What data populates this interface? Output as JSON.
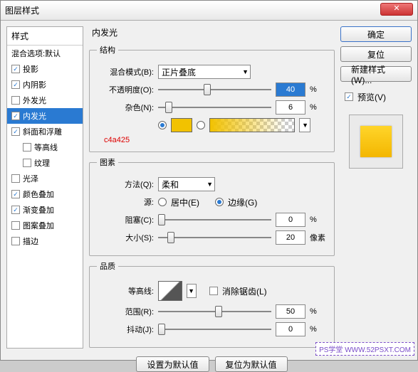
{
  "window": {
    "title": "图层样式",
    "close": "✕"
  },
  "left": {
    "header": "样式",
    "subheader": "混合选项:默认",
    "items": [
      {
        "label": "投影",
        "checked": true
      },
      {
        "label": "内阴影",
        "checked": true
      },
      {
        "label": "外发光",
        "checked": false
      },
      {
        "label": "内发光",
        "checked": true,
        "selected": true
      },
      {
        "label": "斜面和浮雕",
        "checked": true
      },
      {
        "label": "等高线",
        "checked": false,
        "indent": true
      },
      {
        "label": "纹理",
        "checked": false,
        "indent": true
      },
      {
        "label": "光泽",
        "checked": false
      },
      {
        "label": "颜色叠加",
        "checked": true
      },
      {
        "label": "渐变叠加",
        "checked": true
      },
      {
        "label": "图案叠加",
        "checked": false
      },
      {
        "label": "描边",
        "checked": false
      }
    ]
  },
  "mid": {
    "title": "内发光",
    "structure": {
      "legend": "结构",
      "blendMode": {
        "label": "混合模式(B):",
        "value": "正片叠底"
      },
      "opacity": {
        "label": "不透明度(O):",
        "value": "40",
        "unit": "%",
        "pos": 40
      },
      "noise": {
        "label": "杂色(N):",
        "value": "6",
        "unit": "%",
        "pos": 6
      },
      "colorSwatch": "#f2c200",
      "hexNote": "c4a425"
    },
    "elements": {
      "legend": "图素",
      "technique": {
        "label": "方法(Q):",
        "value": "柔和"
      },
      "source": {
        "label": "源:",
        "center": "居中(E)",
        "edge": "边缘(G)",
        "selected": "edge"
      },
      "choke": {
        "label": "阻塞(C):",
        "value": "0",
        "unit": "%",
        "pos": 0
      },
      "size": {
        "label": "大小(S):",
        "value": "20",
        "unit": "像素",
        "pos": 8
      }
    },
    "quality": {
      "legend": "品质",
      "contour": {
        "label": "等高线:",
        "antiAliased": "消除锯齿(L)",
        "aaChecked": false
      },
      "range": {
        "label": "范围(R):",
        "value": "50",
        "unit": "%",
        "pos": 50
      },
      "jitter": {
        "label": "抖动(J):",
        "value": "0",
        "unit": "%",
        "pos": 0
      }
    },
    "buttons": {
      "setDefault": "设置为默认值",
      "resetDefault": "复位为默认值"
    }
  },
  "right": {
    "ok": "确定",
    "cancel": "复位",
    "newStyle": "新建样式(W)...",
    "preview": {
      "label": "预览(V)",
      "checked": true
    }
  },
  "watermark": "PS学堂  WWW.52PSXT.COM"
}
